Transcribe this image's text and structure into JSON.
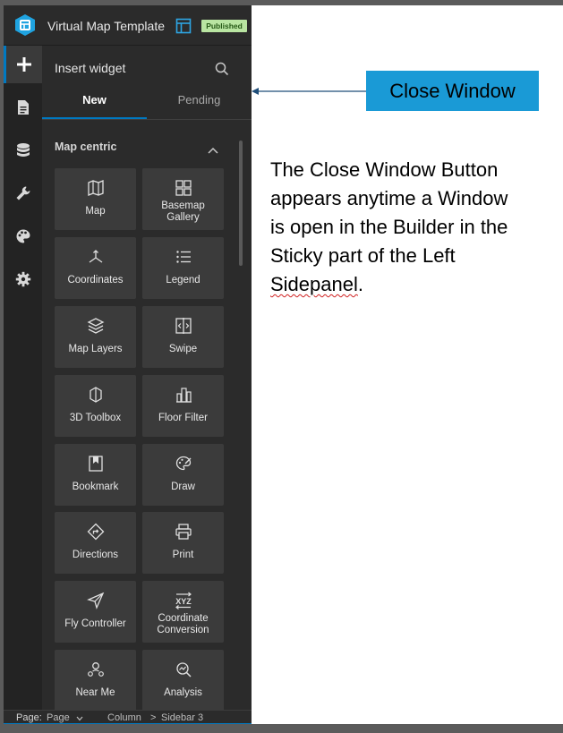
{
  "header": {
    "app_title": "Virtual Map Template",
    "status_badge": "Published",
    "logo_icon": "experience-builder-logo-icon",
    "layout_icon": "page-layout-icon"
  },
  "rail": {
    "items": [
      {
        "icon": "plus-icon",
        "active": true
      },
      {
        "icon": "page-icon"
      },
      {
        "icon": "data-icon"
      },
      {
        "icon": "wrench-icon"
      },
      {
        "icon": "palette-icon"
      },
      {
        "icon": "gear-icon"
      }
    ],
    "help_icon": "help-icon"
  },
  "panel": {
    "title": "Insert widget",
    "search_icon": "search-icon",
    "tabs": [
      {
        "label": "New",
        "active": true
      },
      {
        "label": "Pending",
        "active": false
      }
    ],
    "section": {
      "title": "Map centric",
      "expanded": true
    },
    "widgets": [
      {
        "label": "Map",
        "icon": "map-icon"
      },
      {
        "label": "Basemap Gallery",
        "label_lines": [
          "Basemap",
          "Gallery"
        ],
        "icon": "basemap-gallery-icon"
      },
      {
        "label": "Coordinates",
        "icon": "coordinates-icon"
      },
      {
        "label": "Legend",
        "icon": "legend-icon"
      },
      {
        "label": "Map Layers",
        "icon": "layers-icon"
      },
      {
        "label": "Swipe",
        "icon": "swipe-icon"
      },
      {
        "label": "3D Toolbox",
        "icon": "3d-toolbox-icon"
      },
      {
        "label": "Floor Filter",
        "icon": "floor-filter-icon"
      },
      {
        "label": "Bookmark",
        "icon": "bookmark-icon"
      },
      {
        "label": "Draw",
        "icon": "draw-icon"
      },
      {
        "label": "Directions",
        "icon": "directions-icon"
      },
      {
        "label": "Print",
        "icon": "print-icon"
      },
      {
        "label": "Fly Controller",
        "icon": "fly-controller-icon"
      },
      {
        "label": "Coordinate Conversion",
        "label_lines": [
          "Coordinate",
          "Conversion"
        ],
        "icon": "xyz-conversion-icon"
      },
      {
        "label": "Near Me",
        "icon": "near-me-icon"
      },
      {
        "label": "Analysis",
        "icon": "analysis-icon"
      }
    ]
  },
  "footer": {
    "page_label": "Page:",
    "page_value": "Page",
    "column": "Column",
    "separator": ">",
    "sidebar": "Sidebar 3"
  },
  "callout": {
    "label": "Close Window",
    "color": "#1a9ad6"
  },
  "description": {
    "lines": [
      "The Close Window Button",
      "appears anytime a Window",
      "is open in the Builder in the",
      "Sticky part of the Left"
    ],
    "last_word": "Sidepanel",
    "last_punct": "."
  },
  "colors": {
    "accent": "#0079c1",
    "panel_bg": "#2b2b2b",
    "tile_bg": "#3b3b3b",
    "badge_bg": "#b9e5a2"
  }
}
